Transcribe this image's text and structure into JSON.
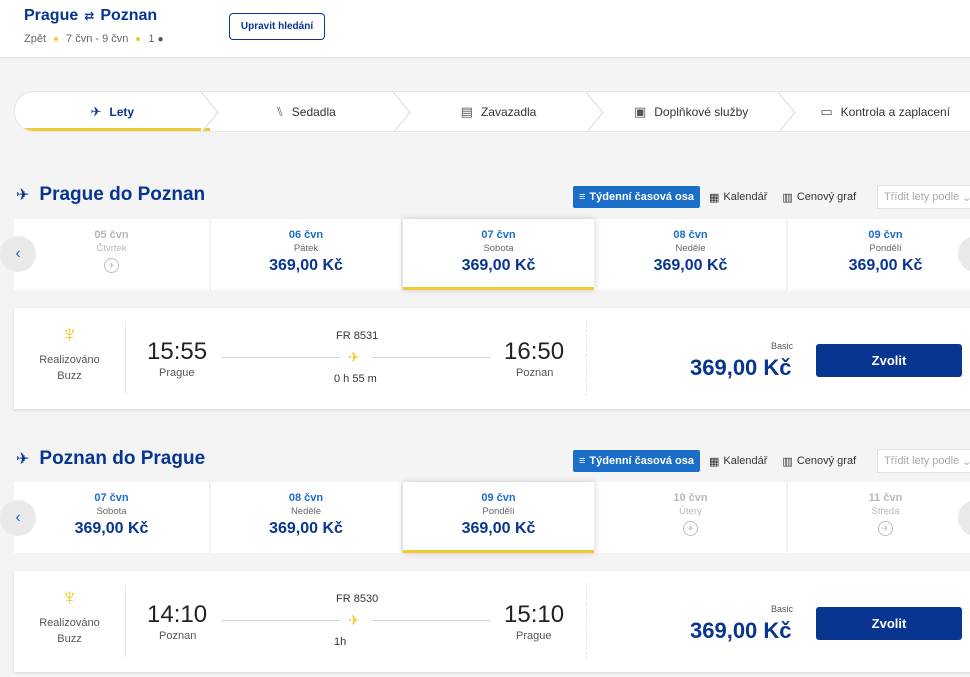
{
  "header": {
    "origin": "Prague",
    "destination": "Poznan",
    "trip_type": "Zpět",
    "dates": "7 čvn - 9 čvn",
    "passengers": "1",
    "edit_button": "Upravit hledání"
  },
  "stepper": [
    {
      "label": "Lety",
      "icon": "plane-icon",
      "glyph": "✈",
      "active": true
    },
    {
      "label": "Sedadla",
      "icon": "seat-icon",
      "glyph": "⑊",
      "active": false
    },
    {
      "label": "Zavazadla",
      "icon": "luggage-icon",
      "glyph": "▤",
      "active": false
    },
    {
      "label": "Doplňkové služby",
      "icon": "bus-icon",
      "glyph": "▣",
      "active": false
    },
    {
      "label": "Kontrola a zaplacení",
      "icon": "card-icon",
      "glyph": "▭",
      "active": false
    }
  ],
  "view_toggle": {
    "weekly": "Týdenní časová osa",
    "calendar": "Kalendář",
    "price_chart": "Cenový graf",
    "sort_placeholder": "Třídit lety podle"
  },
  "outbound": {
    "title": "Prague do Poznan",
    "dates": [
      {
        "date": "05 čvn",
        "day": "Čtvrtek",
        "price": "",
        "disabled": true,
        "selected": false
      },
      {
        "date": "06 čvn",
        "day": "Pátek",
        "price": "369,00 Kč",
        "disabled": false,
        "selected": false
      },
      {
        "date": "07 čvn",
        "day": "Sobota",
        "price": "369,00 Kč",
        "disabled": false,
        "selected": true
      },
      {
        "date": "08 čvn",
        "day": "Neděle",
        "price": "369,00 Kč",
        "disabled": false,
        "selected": false
      },
      {
        "date": "09 čvn",
        "day": "Pondělí",
        "price": "369,00 Kč",
        "disabled": false,
        "selected": false
      }
    ],
    "flight": {
      "operator_line1": "Realizováno",
      "operator_line2": "Buzz",
      "depart_time": "15:55",
      "depart_city": "Prague",
      "flight_no": "FR 8531",
      "duration": "0 h 55 m",
      "arrive_time": "16:50",
      "arrive_city": "Poznan",
      "fare": "Basic",
      "price": "369,00 Kč",
      "select_label": "Zvolit"
    }
  },
  "inbound": {
    "title": "Poznan do Prague",
    "dates": [
      {
        "date": "07 čvn",
        "day": "Sobota",
        "price": "369,00 Kč",
        "disabled": false,
        "selected": false
      },
      {
        "date": "08 čvn",
        "day": "Neděle",
        "price": "369,00 Kč",
        "disabled": false,
        "selected": false
      },
      {
        "date": "09 čvn",
        "day": "Pondělí",
        "price": "369,00 Kč",
        "disabled": false,
        "selected": true
      },
      {
        "date": "10 čvn",
        "day": "Úterý",
        "price": "",
        "disabled": true,
        "selected": false
      },
      {
        "date": "11 čvn",
        "day": "Středa",
        "price": "",
        "disabled": true,
        "selected": false
      }
    ],
    "flight": {
      "operator_line1": "Realizováno",
      "operator_line2": "Buzz",
      "depart_time": "14:10",
      "depart_city": "Poznan",
      "flight_no": "FR 8530",
      "duration": "1h",
      "arrive_time": "15:10",
      "arrive_city": "Prague",
      "fare": "Basic",
      "price": "369,00 Kč",
      "select_label": "Zvolit"
    }
  }
}
